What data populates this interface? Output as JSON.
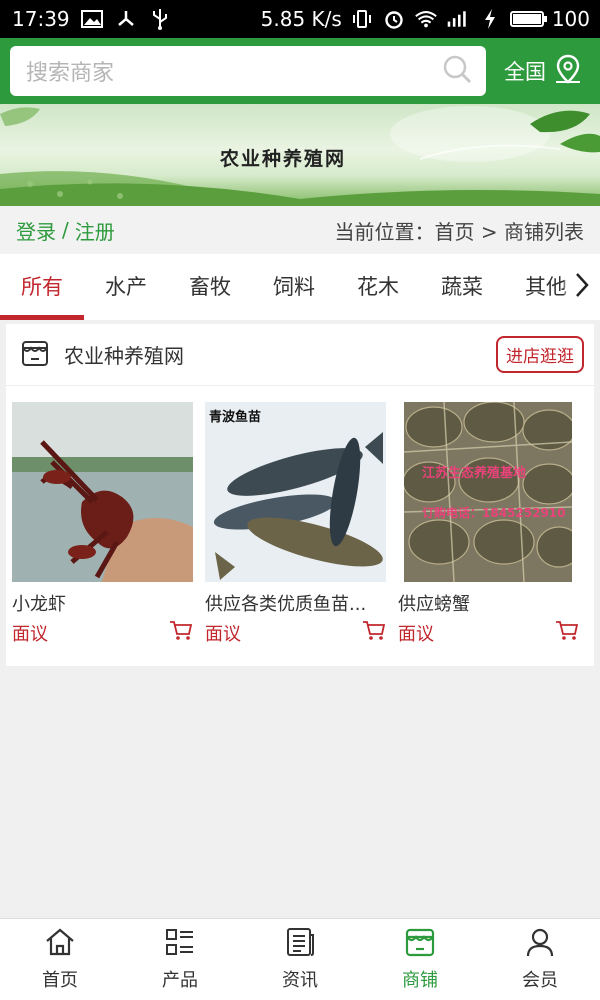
{
  "status_bar": {
    "time": "17:39",
    "speed": "5.85 K/s",
    "battery": "100",
    "battery_level": 1.0,
    "icons": [
      "image-icon",
      "share-icon",
      "usb-icon",
      "vibrate-icon",
      "alarm-icon",
      "wifi-icon",
      "signal-4g-icon",
      "charging-icon",
      "battery-icon"
    ]
  },
  "header": {
    "search_placeholder": "搜索商家",
    "region_label": "全国"
  },
  "banner": {
    "title": "农业种养殖网"
  },
  "location": {
    "login": "登录",
    "separator": "/",
    "register": "注册",
    "breadcrumb": "当前位置：首页 > 商铺列表"
  },
  "tabs": [
    {
      "label": "所有",
      "active": true
    },
    {
      "label": "水产",
      "active": false
    },
    {
      "label": "畜牧",
      "active": false
    },
    {
      "label": "饲料",
      "active": false
    },
    {
      "label": "花木",
      "active": false
    },
    {
      "label": "蔬菜",
      "active": false
    },
    {
      "label": "其他",
      "active": false
    }
  ],
  "shop": {
    "name": "农业种养殖网",
    "enter_button": "进店逛逛",
    "products": [
      {
        "name": "小龙虾",
        "price": "面议",
        "image_caption": ""
      },
      {
        "name": "供应各类优质鱼苗...",
        "price": "面议",
        "image_caption": "青波鱼苗"
      },
      {
        "name": "供应螃蟹",
        "price": "面议",
        "image_caption": "江苏生态养殖基地",
        "image_caption2": "订购电话：1845252910"
      }
    ]
  },
  "bottom_nav": [
    {
      "label": "首页",
      "icon": "home-icon",
      "active": false
    },
    {
      "label": "产品",
      "icon": "product-list-icon",
      "active": false
    },
    {
      "label": "资讯",
      "icon": "news-icon",
      "active": false
    },
    {
      "label": "商铺",
      "icon": "shop-icon",
      "active": true
    },
    {
      "label": "会员",
      "icon": "member-icon",
      "active": false
    }
  ],
  "colors": {
    "brand_green": "#2e9a3e",
    "accent_red": "#c1272d"
  }
}
